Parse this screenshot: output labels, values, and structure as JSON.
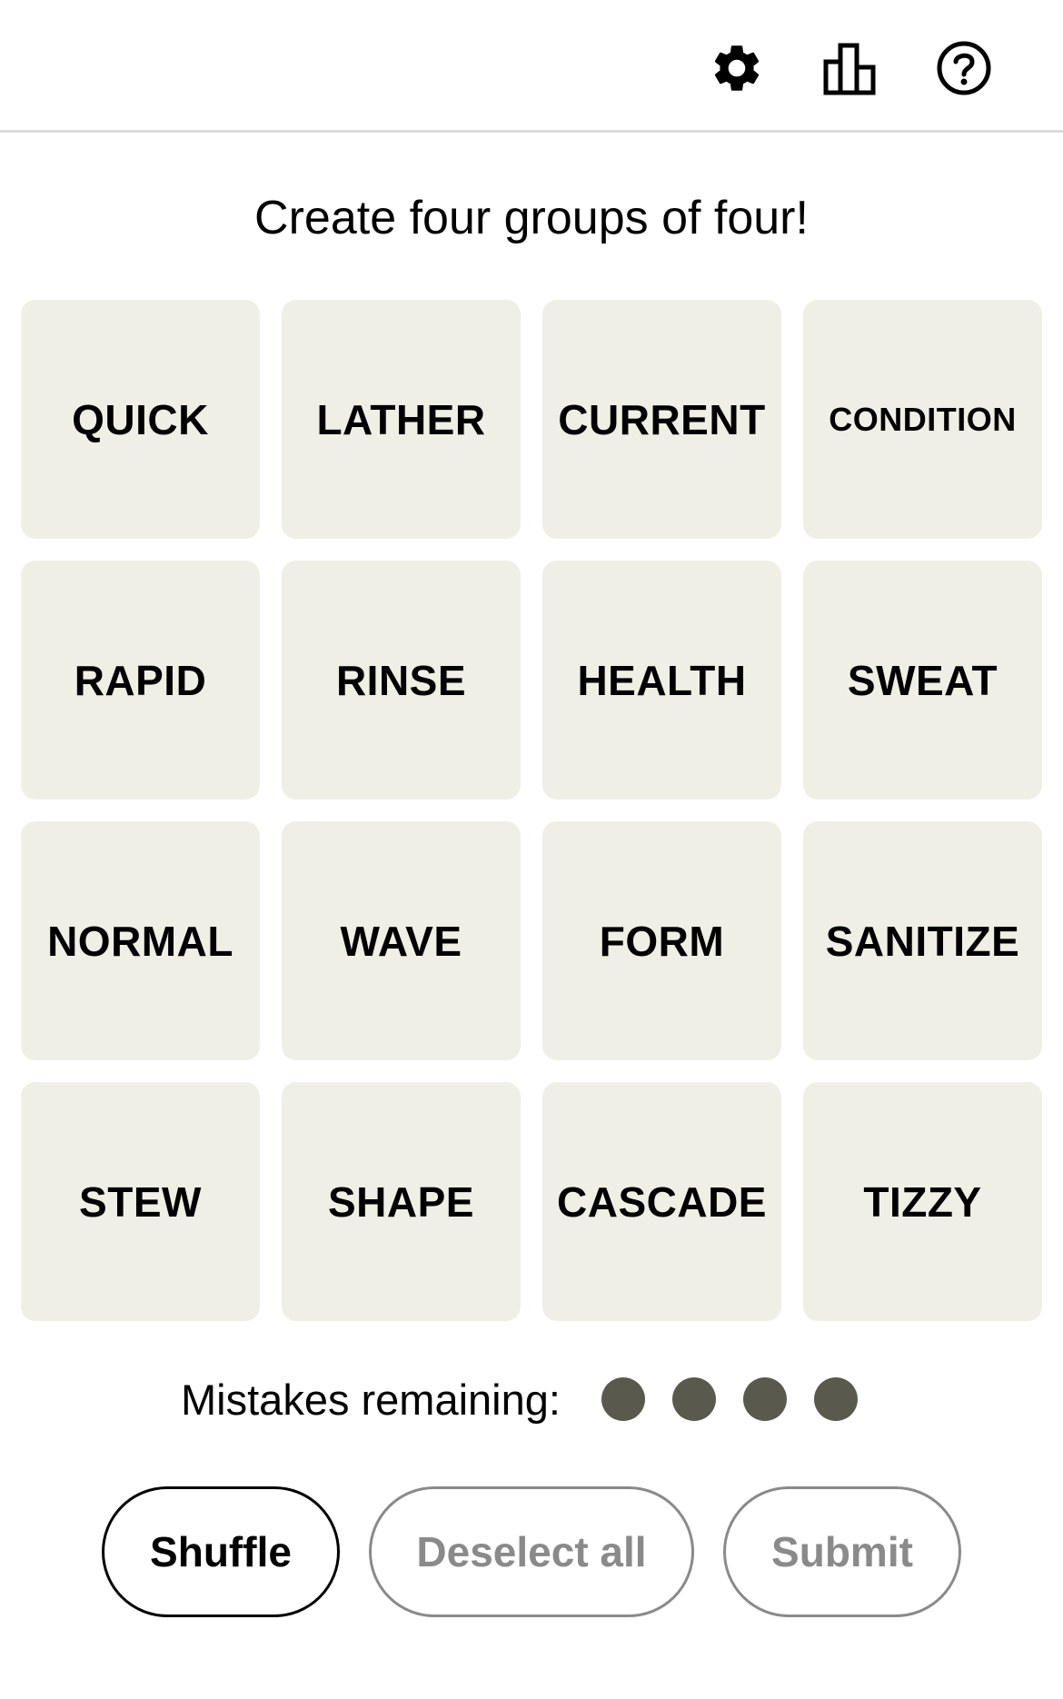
{
  "header": {
    "icons": [
      "gear-icon",
      "leaderboard-icon",
      "help-icon"
    ]
  },
  "instruction": "Create four groups of four!",
  "tiles": [
    "QUICK",
    "LATHER",
    "CURRENT",
    "CONDITION",
    "RAPID",
    "RINSE",
    "HEALTH",
    "SWEAT",
    "NORMAL",
    "WAVE",
    "FORM",
    "SANITIZE",
    "STEW",
    "SHAPE",
    "CASCADE",
    "TIZZY"
  ],
  "mistakes": {
    "label": "Mistakes remaining:",
    "remaining": 4
  },
  "actions": {
    "shuffle_label": "Shuffle",
    "deselect_label": "Deselect all",
    "submit_label": "Submit"
  },
  "colors": {
    "tile_bg": "#efefe6",
    "dot": "#5a594e",
    "disabled": "#8a8a8a"
  }
}
